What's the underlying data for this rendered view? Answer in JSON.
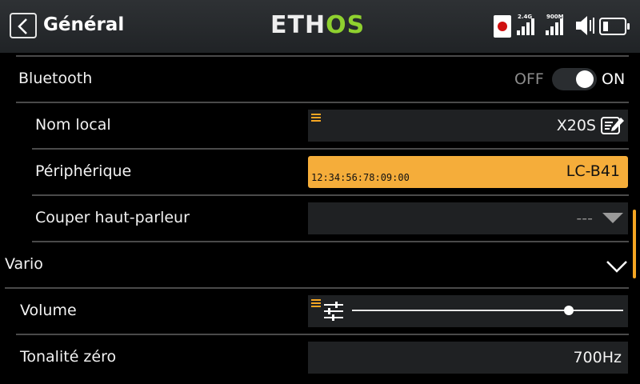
{
  "header": {
    "title": "Général",
    "logo_main": "ETH",
    "logo_accent": "OS",
    "signal_24g_label": "2.4G",
    "signal_900m_label": "900M"
  },
  "bluetooth": {
    "label": "Bluetooth",
    "off_label": "OFF",
    "on_label": "ON",
    "state": "on"
  },
  "local_name": {
    "label": "Nom local",
    "value": "X20S"
  },
  "peripheral": {
    "label": "Périphérique",
    "address": "12:34:56:78:09:00",
    "device": "LC-B41"
  },
  "speaker_cut": {
    "label": "Couper haut-parleur",
    "value": "---"
  },
  "vario": {
    "label": "Vario"
  },
  "volume": {
    "label": "Volume",
    "level_fraction": 0.8
  },
  "zero_tone": {
    "label": "Tonalité zéro",
    "value": "700Hz"
  },
  "colors": {
    "accent": "#f5a623",
    "logo_green": "#8fd12f",
    "record_red": "#d01010"
  }
}
